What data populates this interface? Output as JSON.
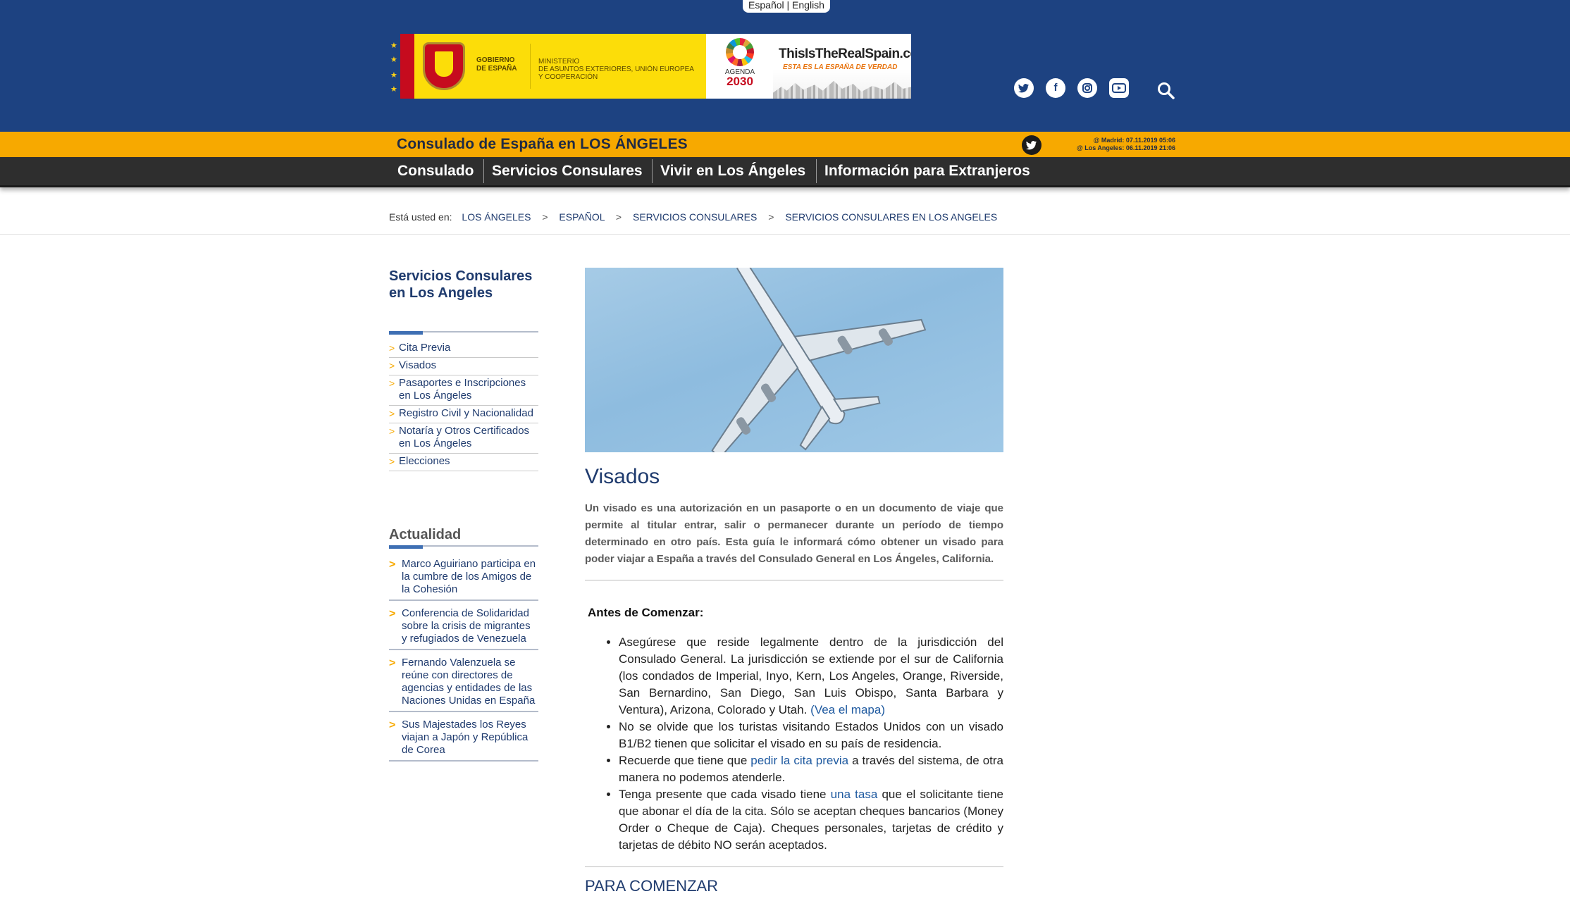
{
  "header": {
    "lang_es": "Español",
    "lang_sep": "|",
    "lang_en": "English",
    "logo": {
      "gob_line1": "GOBIERNO",
      "gob_line2": "DE ESPAÑA",
      "min_line1": "MINISTERIO",
      "min_line2": "DE ASUNTOS EXTERIORES, UNIÓN EUROPEA",
      "min_line3": "Y COOPERACIÓN",
      "agenda_line1": "AGENDA",
      "agenda_line2": "2030",
      "real_title": "ThisIsTheRealSpain.com",
      "real_tagline": "ESTA ES LA ESPAÑA DE VERDAD"
    },
    "social_icons": [
      "twitter-icon",
      "facebook-icon",
      "instagram-icon",
      "youtube-icon",
      "search-icon"
    ],
    "brand_color": "#1d4281"
  },
  "consulate": {
    "title": "Consulado de España en LOS ÁNGELES",
    "clock_madrid": "@ Madrid: 07.11.2019 05:06",
    "clock_la": "@ Los Angeles: 06.11.2019 21:06",
    "band_color": "#f7a900"
  },
  "nav": {
    "items": [
      {
        "label": "Consulado"
      },
      {
        "label": "Servicios Consulares"
      },
      {
        "label": "Vivir en Los Ángeles"
      },
      {
        "label": "Información para Extranjeros"
      }
    ]
  },
  "breadcrumb": {
    "prefix": "Está usted en:",
    "items": [
      "LOS ÁNGELES",
      "ESPAÑOL",
      "SERVICIOS CONSULARES",
      "SERVICIOS CONSULARES EN LOS ANGELES"
    ],
    "sep": ">"
  },
  "sidebar": {
    "heading": "Servicios Consulares en Los Angeles",
    "menu": [
      "Cita Previa",
      "Visados",
      "Pasaportes e Inscripciones en Los Ángeles",
      "Registro Civil y Nacionalidad",
      "Notaría y Otros Certificados en Los Ángeles",
      "Elecciones"
    ],
    "news_heading": "Actualidad",
    "news": [
      "Marco Aguiriano participa en la cumbre de los Amigos de la Cohesión",
      "Conferencia de Solidaridad sobre la crisis de migrantes y refugiados de Venezuela",
      "Fernando Valenzuela se reúne con directores de agencias y entidades de las Naciones Unidas en España",
      "Sus Majestades los Reyes viajan a Japón y República de Corea"
    ],
    "chevron": ">"
  },
  "main": {
    "title": "Visados",
    "intro": "Un visado es una autorización en un pasaporte o en un documento de viaje que permite al titular entrar, salir o permanecer durante un período de tiempo determinado en otro país. Esta guía le informará cómo obtener un visado para poder viajar a España a través del Consulado General en Los Ángeles, California.",
    "before_heading": "Antes de Comenzar:",
    "b1_text": "Asegúrese que reside legalmente dentro de la jurisdicción del Consulado General. La jurisdicción se extiende por el sur de California (los condados de Imperial, Inyo, Kern, Los Angeles, Orange, Riverside, San Bernardino, San Diego, San Luis Obispo, Santa Barbara y Ventura), Arizona, Colorado y Utah. ",
    "b1_link": "(Vea el mapa)",
    "b2_text": "No se olvide que los turistas visitando Estados Unidos con un visado B1/B2 tienen que solicitar el visado en su país de residencia.",
    "b3_pre": "Recuerde que tiene que ",
    "b3_link": "pedir la cita previa",
    "b3_post": " a través del sistema, de otra manera no podemos atenderle.",
    "b4_pre": "Tenga presente que cada visado tiene ",
    "b4_link": "una tasa",
    "b4_post": " que el solicitante tiene que abonar el día de la cita. Sólo se aceptan cheques bancarios (Money Order o Cheque de Caja). Cheques personales, tarjetas de crédito y tarjetas de débito NO serán aceptados.",
    "section2": "PARA COMENZAR"
  }
}
